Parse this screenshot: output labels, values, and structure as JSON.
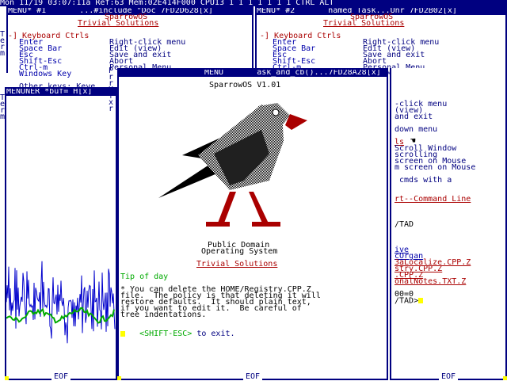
{
  "statusbar": {
    "text": "Mon 11/19 03:07:11a Ref:63 Mem:02E414F000 CPU13 1 1 1 1 1 1 1 CTRL ALT"
  },
  "win1": {
    "title": "MENU* #1       ...#include \"Doc 7FD2D628[x]",
    "section": "-] Keyboard Ctrls",
    "app_name": "SparrowOS",
    "app_sub": "Trivial Solutions",
    "left_col": [
      "Enter",
      "Space Bar",
      "Esc",
      "Shift-Esc",
      "Ctrl-m",
      "Windows Key"
    ],
    "right_col": [
      "Right-click menu",
      "Edit (view)",
      "Save and exit",
      "Abort",
      "Personal Menu"
    ],
    "other_keys": "Other keys: Keye"
  },
  "win2": {
    "title": "MENU* #2       named Task...Unr 7FD2B02[x]",
    "section": "-] Keyboard Ctrls",
    "app_name": "SparrowOS",
    "app_sub": "Trivial Solutions",
    "left_col": [
      "Enter",
      "Space Bar",
      "Esc",
      "Shift-Esc",
      "Ctrl-m"
    ],
    "right_col": [
      "Right-click menu",
      "Edit (view)",
      "Save and exit",
      "Abort",
      "Personal Menu",
      "down Menu"
    ]
  },
  "win3": {
    "title": "MENUNER *buf= H[x]"
  },
  "win_main": {
    "title": "MENU       ask_and_cb()...7FD28A28[x]",
    "os_title": "SparrowOS V1.01",
    "public": "Public Domain",
    "operating": "Operating System",
    "company": "Trivial Solutions",
    "tip_label": "Tip of day",
    "tip_lines": [
      "* You can delete the HOME/Registry.CPP.Z",
      "file.  The policy is that deleting it will",
      "restore defaults.  It should plain text,",
      "if you want to edit it.  Be careful of",
      "tree indentations."
    ],
    "exit_key": "<SHIFT-ESC>",
    "exit_text": " to exit."
  },
  "win_right": {
    "lines": [
      "-click menu",
      "(view)",
      "and exit",
      "",
      "down menu",
      "",
      "ls",
      "Scroll Window",
      "scrolling",
      "screen on Mouse",
      "m screen on Mouse",
      "",
      " cmds with a",
      "",
      "",
      "rt--Command Line"
    ],
    "tad": "/TAD",
    "files": [
      "ive",
      "cOrgan",
      "3aLocalize.CPP.Z",
      "stry.CPP.Z",
      ".CPP.Z",
      "onalNotes.TXT.Z"
    ],
    "zero": "00=0",
    "prompt": "/TAD>"
  },
  "left_strip": {
    "chars": [
      "T",
      "e",
      "r",
      "m",
      "",
      "",
      "",
      "",
      "",
      "",
      "T",
      "e",
      "r",
      "m"
    ]
  },
  "eof_label": "EOF",
  "mid_strip": {
    "chars": [
      "P",
      "r",
      "r",
      "H",
      "f",
      "x",
      "r"
    ]
  },
  "colors": {
    "navy": "#000080",
    "red": "#aa0000",
    "green": "#00aa00",
    "yellow": "#ffff00",
    "blue_wave": "#0000cc"
  }
}
